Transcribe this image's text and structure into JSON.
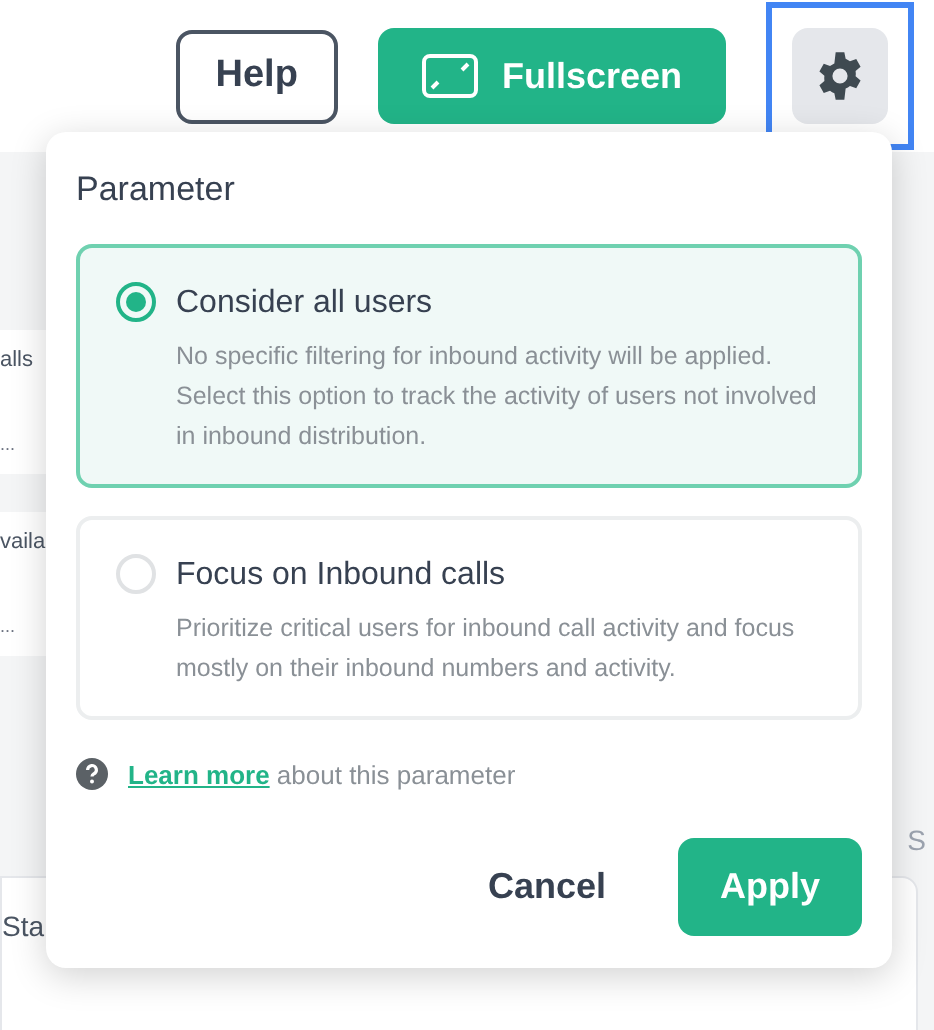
{
  "toolbar": {
    "help": "Help",
    "fullscreen": "Fullscreen",
    "settings_focused": true
  },
  "background": {
    "cards": [
      {
        "label": "alls",
        "note": "..."
      },
      {
        "label": "vaila",
        "note": "..."
      }
    ],
    "side_label": "S",
    "table": {
      "header": "Sta"
    }
  },
  "popup": {
    "title": "Parameter",
    "options": [
      {
        "label": "Consider all users",
        "description": "No specific filtering for inbound activity will be applied. Select this option to track the activity of users not involved in inbound distribution.",
        "selected": true
      },
      {
        "label": "Focus on Inbound calls",
        "description": "Prioritize critical users for inbound call activity and focus mostly on their inbound numbers and activity.",
        "selected": false
      }
    ],
    "help_link": "Learn more",
    "help_text": "about this parameter",
    "buttons": {
      "cancel": "Cancel",
      "apply": "Apply"
    }
  }
}
